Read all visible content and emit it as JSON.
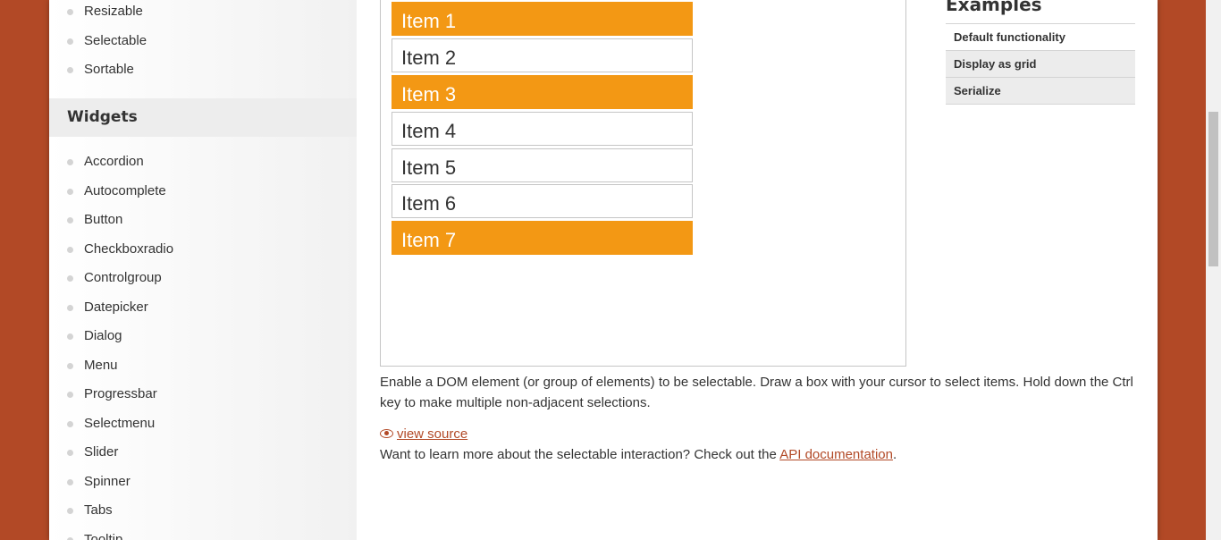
{
  "sidebar": {
    "top_items": [
      {
        "label": "Resizable"
      },
      {
        "label": "Selectable"
      },
      {
        "label": "Sortable"
      }
    ],
    "widgets_heading": "Widgets",
    "widget_items": [
      {
        "label": "Accordion"
      },
      {
        "label": "Autocomplete"
      },
      {
        "label": "Button"
      },
      {
        "label": "Checkboxradio"
      },
      {
        "label": "Controlgroup"
      },
      {
        "label": "Datepicker"
      },
      {
        "label": "Dialog"
      },
      {
        "label": "Menu"
      },
      {
        "label": "Progressbar"
      },
      {
        "label": "Selectmenu"
      },
      {
        "label": "Slider"
      },
      {
        "label": "Spinner"
      },
      {
        "label": "Tabs"
      },
      {
        "label": "Tooltip"
      }
    ]
  },
  "demo": {
    "items": [
      {
        "label": "Item 1",
        "selected": true
      },
      {
        "label": "Item 2",
        "selected": false
      },
      {
        "label": "Item 3",
        "selected": true
      },
      {
        "label": "Item 4",
        "selected": false
      },
      {
        "label": "Item 5",
        "selected": false
      },
      {
        "label": "Item 6",
        "selected": false
      },
      {
        "label": "Item 7",
        "selected": true
      }
    ]
  },
  "content": {
    "description": "Enable a DOM element (or group of elements) to be selectable. Draw a box with your cursor to select items. Hold down the Ctrl key to make multiple non-adjacent selections.",
    "view_source": "view source",
    "learn_more_prefix": "Want to learn more about the selectable interaction? Check out the ",
    "api_link": "API documentation",
    "learn_more_suffix": "."
  },
  "examples": {
    "title": "Examples",
    "items": [
      {
        "label": "Default functionality",
        "active": true
      },
      {
        "label": "Display as grid",
        "active": false
      },
      {
        "label": "Serialize",
        "active": false
      }
    ]
  },
  "colors": {
    "accent": "#b24926",
    "selected_item": "#f39814"
  },
  "icons": {
    "view_source": "eye-icon"
  }
}
